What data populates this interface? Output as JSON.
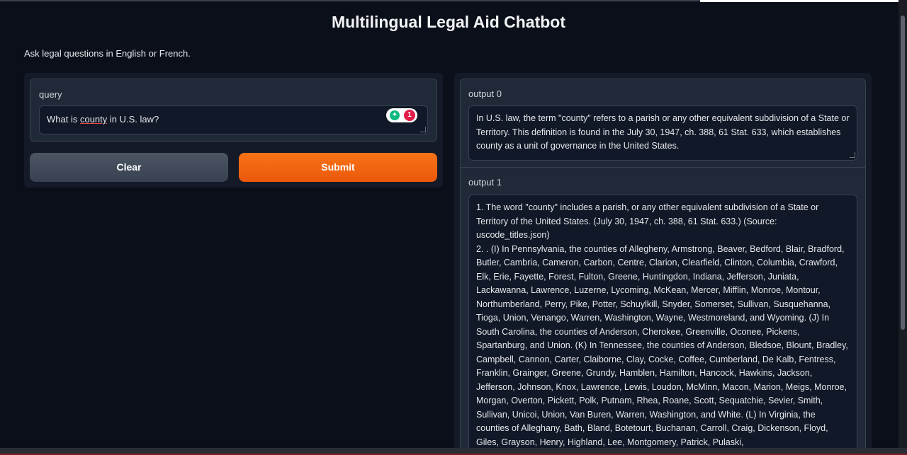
{
  "header": {
    "title": "Multilingual Legal Aid Chatbot",
    "subtitle": "Ask legal questions in English or French."
  },
  "query": {
    "label": "query",
    "value_before": "What is ",
    "value_misspelled": "county",
    "value_after": " in U.S. law?",
    "extension_badge_count": "1"
  },
  "buttons": {
    "clear_label": "Clear",
    "submit_label": "Submit"
  },
  "outputs": [
    {
      "label": "output 0",
      "text": "In U.S. law, the term \"county\" refers to a parish or any other equivalent subdivision of a State or Territory. This definition is found in the July 30, 1947, ch. 388, 61 Stat. 633, which establishes county as a unit of governance in the United States."
    },
    {
      "label": "output 1",
      "text": "1. The word \"county\" includes a parish, or any other equivalent subdivision of a State or Territory of the United States. (July 30, 1947, ch. 388, 61 Stat. 633.) (Source: uscode_titles.json)\n2. . (I) In Pennsylvania, the counties of Allegheny, Armstrong, Beaver, Bedford, Blair, Bradford, Butler, Cambria, Cameron, Carbon, Centre, Clarion, Clearfield, Clinton, Columbia, Crawford, Elk, Erie, Fayette, Forest, Fulton, Greene, Huntingdon, Indiana, Jefferson, Juniata, Lackawanna, Lawrence, Luzerne, Lycoming, McKean, Mercer, Mifflin, Monroe, Montour, Northumberland, Perry, Pike, Potter, Schuylkill, Snyder, Somerset, Sullivan, Susquehanna, Tioga, Union, Venango, Warren, Washington, Wayne, Westmoreland, and Wyoming. (J) In South Carolina, the counties of Anderson, Cherokee, Greenville, Oconee, Pickens, Spartanburg, and Union. (K) In Tennessee, the counties of Anderson, Bledsoe, Blount, Bradley, Campbell, Cannon, Carter, Claiborne, Clay, Cocke, Coffee, Cumberland, De Kalb, Fentress, Franklin, Grainger, Greene, Grundy, Hamblen, Hamilton, Hancock, Hawkins, Jackson, Jefferson, Johnson, Knox, Lawrence, Lewis, Loudon, McMinn, Macon, Marion, Meigs, Monroe, Morgan, Overton, Pickett, Polk, Putnam, Rhea, Roane, Scott, Sequatchie, Sevier, Smith, Sullivan, Unicoi, Union, Van Buren, Warren, Washington, and White. (L) In Virginia, the counties of Alleghany, Bath, Bland, Botetourt, Buchanan, Carroll, Craig, Dickenson, Floyd, Giles, Grayson, Henry, Highland, Lee, Montgomery, Patrick, Pulaski,"
    }
  ],
  "colors": {
    "background": "#0b0f19",
    "submit_accent": "#f97316",
    "spellcheck": "#ef4444"
  },
  "icons": [
    "grammar-extension-icon",
    "resize-handle-icon"
  ]
}
